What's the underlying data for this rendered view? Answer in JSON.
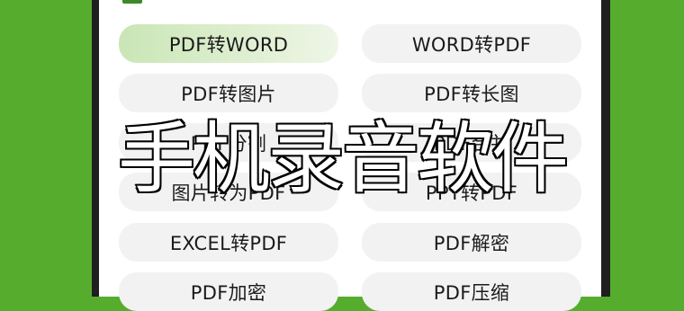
{
  "buttons": [
    {
      "label": "PDF转WORD",
      "active": true
    },
    {
      "label": "WORD转PDF",
      "active": false
    },
    {
      "label": "PDF转图片",
      "active": false
    },
    {
      "label": "PDF转长图",
      "active": false
    },
    {
      "label": "PDF分割",
      "active": false
    },
    {
      "label": "PDF合并",
      "active": false
    },
    {
      "label": "图片转为PDF",
      "active": false
    },
    {
      "label": "PPT转PDF",
      "active": false
    },
    {
      "label": "EXCEL转PDF",
      "active": false
    },
    {
      "label": "PDF解密",
      "active": false
    },
    {
      "label": "PDF加密",
      "active": false
    },
    {
      "label": "PDF压缩",
      "active": false
    }
  ],
  "overlay_title": "手机录音软件",
  "colors": {
    "background": "#56ad2d",
    "active_button": "#c9e6b6",
    "button": "#f2f2f2"
  }
}
